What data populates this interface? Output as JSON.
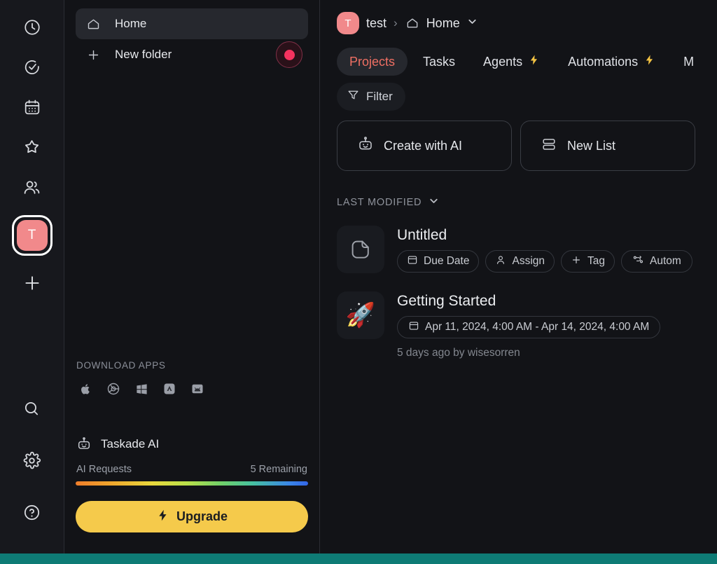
{
  "rail": {
    "icons": [
      {
        "name": "clock-icon",
        "label": "Recent"
      },
      {
        "name": "check-circle-icon",
        "label": "Tasks"
      },
      {
        "name": "calendar-icon",
        "label": "Calendar"
      },
      {
        "name": "star-icon",
        "label": "Favorites"
      },
      {
        "name": "people-icon",
        "label": "Contacts"
      }
    ],
    "avatar_initial": "T",
    "add_workspace_label": "+",
    "bottom_icons": [
      {
        "name": "search-icon",
        "label": "Search"
      },
      {
        "name": "gear-icon",
        "label": "Settings"
      },
      {
        "name": "help-icon",
        "label": "Help"
      }
    ]
  },
  "sidebar": {
    "items": [
      {
        "label": "Home",
        "icon": "home-icon",
        "active": true
      },
      {
        "label": "New folder",
        "icon": "plus-icon",
        "active": false
      }
    ],
    "recording_indicator": "record-dot",
    "download": {
      "title": "DOWNLOAD APPS",
      "apps": [
        {
          "name": "apple-icon"
        },
        {
          "name": "chrome-icon"
        },
        {
          "name": "windows-icon"
        },
        {
          "name": "app-store-icon"
        },
        {
          "name": "android-icon"
        }
      ]
    },
    "ai": {
      "title": "Taskade AI",
      "requests_label": "AI Requests",
      "remaining_label": "5 Remaining",
      "progress_percent": 100,
      "upgrade_label": "Upgrade"
    }
  },
  "header": {
    "workspace_initial": "T",
    "workspace_name": "test",
    "separator": "›",
    "current_name": "Home"
  },
  "tabs": [
    {
      "label": "Projects",
      "active": true,
      "bolt": false
    },
    {
      "label": "Tasks",
      "active": false,
      "bolt": false
    },
    {
      "label": "Agents",
      "active": false,
      "bolt": true
    },
    {
      "label": "Automations",
      "active": false,
      "bolt": true
    },
    {
      "label": "M",
      "active": false,
      "bolt": false
    }
  ],
  "toolbar": {
    "filter_label": "Filter",
    "create_with_ai_label": "Create with AI",
    "new_list_label": "New List"
  },
  "list": {
    "sort_label": "LAST MODIFIED",
    "projects": [
      {
        "title": "Untitled",
        "icon": "document-icon",
        "emoji": "",
        "chips": [
          {
            "label": "Due Date",
            "icon": "calendar-chip-icon"
          },
          {
            "label": "Assign",
            "icon": "person-icon"
          },
          {
            "label": "Tag",
            "icon": "plus-icon"
          },
          {
            "label": "Autom",
            "icon": "automation-icon"
          }
        ],
        "meta": ""
      },
      {
        "title": "Getting Started",
        "icon": "rocket-emoji",
        "emoji": "🚀",
        "chips": [
          {
            "label": "Apr 11, 2024, 4:00 AM - Apr 14, 2024, 4:00 AM",
            "icon": "calendar-chip-icon"
          }
        ],
        "meta": "5 days ago by wisesorren"
      }
    ]
  },
  "colors": {
    "accent_red": "#ef6f63",
    "avatar_pink": "#f1898b",
    "upgrade_yellow": "#f5ca4b",
    "bolt_yellow": "#f3c343",
    "bottom_bar_teal": "#0e7b75",
    "record_red": "#f5335f"
  }
}
